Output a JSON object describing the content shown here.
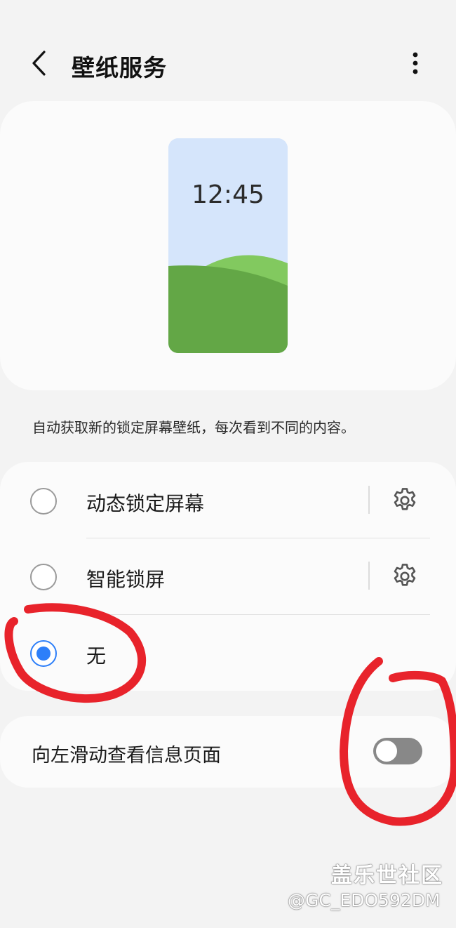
{
  "header": {
    "title": "壁纸服务",
    "back_icon": "chevron-left-icon",
    "more_icon": "more-vertical-icon"
  },
  "preview": {
    "time": "12:45",
    "colors": {
      "sky": "#d5e5fb",
      "hill_front": "#63a746",
      "hill_back": "#82c95f"
    }
  },
  "description": "自动获取新的锁定屏幕壁纸，每次看到不同的内容。",
  "options": [
    {
      "label": "动态锁定屏幕",
      "selected": false,
      "has_settings": true
    },
    {
      "label": "智能锁屏",
      "selected": false,
      "has_settings": true
    },
    {
      "label": "无",
      "selected": true,
      "has_settings": false
    }
  ],
  "toggle": {
    "label": "向左滑动查看信息页面",
    "on": false
  },
  "watermark": {
    "logo": "盖乐世社区",
    "user": "@GC_EDO592DM"
  },
  "colors": {
    "accent": "#2d7ff9",
    "annotation": "#e8232b"
  }
}
